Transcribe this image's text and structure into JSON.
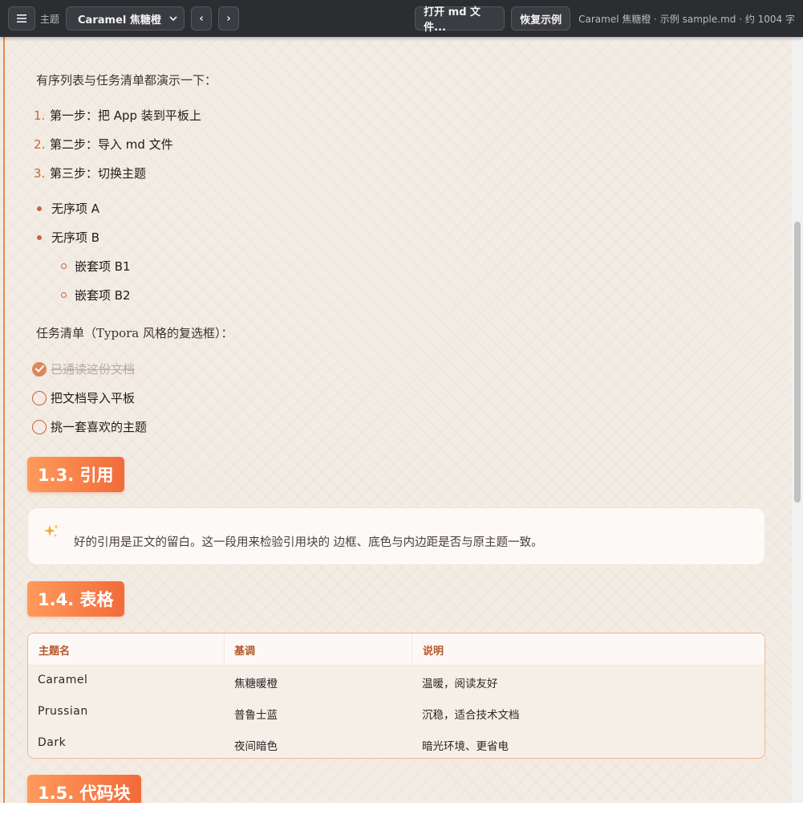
{
  "toolbar": {
    "theme_label": "主题",
    "theme_selected": "Caramel 焦糖橙",
    "prev_label": "‹",
    "next_label": "›",
    "open_file_label": "打开 md 文件...",
    "restore_label": "恢复示例",
    "status": "Caramel 焦糖橙 · 示例 sample.md · 约 1004 字"
  },
  "doc": {
    "lists_intro": "有序列表与任务清单都演示一下：",
    "ordered": [
      {
        "num": "1.",
        "text": "第一步：把 App 装到平板上"
      },
      {
        "num": "2.",
        "text": "第二步：导入 md 文件"
      },
      {
        "num": "3.",
        "text": "第三步：切换主题"
      }
    ],
    "unordered": [
      "无序项 A",
      "无序项 B"
    ],
    "nested": [
      "嵌套项 B1",
      "嵌套项 B2"
    ],
    "tasks_intro": "任务清单（Typora 风格的复选框）：",
    "tasks": [
      {
        "text": "已通读这份文档",
        "done": true
      },
      {
        "text": "把文档导入平板",
        "done": false
      },
      {
        "text": "挑一套喜欢的主题",
        "done": false
      }
    ],
    "h_quote": "1.3. 引用",
    "quote_text": "好的引用是正文的留白。这一段用来检验引用块的 边框、底色与内边距是否与原主题一致。",
    "h_table": "1.4. 表格",
    "table": {
      "headers": [
        "主题名",
        "基调",
        "说明"
      ],
      "rows": [
        [
          "Caramel",
          "焦糖暖橙",
          "温暖，阅读友好"
        ],
        [
          "Prussian",
          "普鲁士蓝",
          "沉稳，适合技术文档"
        ],
        [
          "Dark",
          "夜间暗色",
          "暗光环境、更省电"
        ]
      ]
    },
    "h_code": "1.5. 代码块"
  },
  "colors": {
    "accent": "#f26b3a",
    "toolbar_bg": "#2b2d31",
    "page_bg": "#f3ece4"
  },
  "icons": {
    "menu": "hamburger-menu-icon",
    "select": "chevron-down-icon",
    "quote": "sparkles-icon",
    "task_done": "check-circle-icon",
    "task_open": "empty-circle-icon"
  }
}
